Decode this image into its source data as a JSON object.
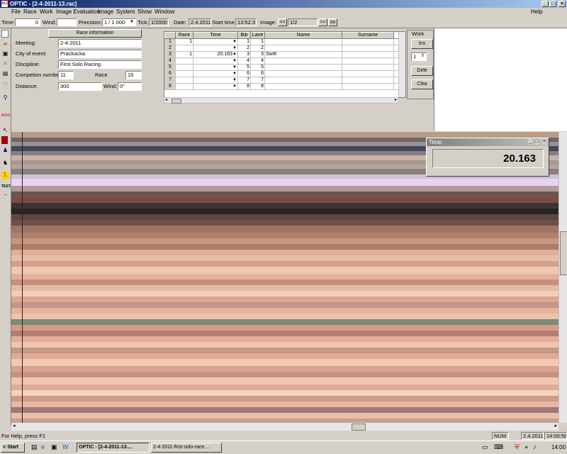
{
  "window": {
    "title": "OPTIC - [2-4-2011-13.rac]",
    "app_icon_text": "ALGE",
    "min_label": "_",
    "max_label": "□",
    "close_label": "×"
  },
  "menu": {
    "items": [
      "File",
      "Race",
      "Work",
      "Image Evaluation",
      "Image",
      "System",
      "Show",
      "Window"
    ],
    "help": "Help"
  },
  "toolbar": {
    "time_label": "Time:",
    "time_value": "0",
    "wind_label": "Wind:",
    "wind_value": "",
    "precision_label": "Precision:",
    "precision_value": "1 / 1 000",
    "tick_label": "Tick:",
    "tick_value": "1/2000",
    "date_label": "Date:",
    "date_value": "2.4.2011",
    "start_label": "Start time",
    "start_value": "13:52:37",
    "image_label": "Image:",
    "prev_label": "<<",
    "image_value": "1/2",
    "next_label": ">>",
    "link_label": "oo"
  },
  "race_info": {
    "header": "Race information",
    "meeting_label": "Meeting:",
    "meeting_value": "2-4-2011",
    "city_label": "City of event:",
    "city_value": "Prackacka",
    "discipline_label": "Discipline:",
    "discipline_value": "First Solo Racing",
    "comp_label": "Competion number:",
    "comp_value": "11",
    "race_label": "Race",
    "race_value": "15",
    "distance_label": "Distance:",
    "distance_value": "300",
    "wind_label": "Wind:",
    "wind_value": "0\""
  },
  "results": {
    "columns": [
      "",
      "Rank",
      "Time",
      "Bib",
      "Lane",
      "Name",
      "Surname"
    ],
    "rows": [
      {
        "n": "1",
        "rank": "1",
        "time": "",
        "bib": "1",
        "lane": "1",
        "name": "",
        "surname": ""
      },
      {
        "n": "2",
        "rank": "",
        "time": "",
        "bib": "2",
        "lane": "2",
        "name": "",
        "surname": ""
      },
      {
        "n": "3",
        "rank": "1",
        "time": "20.163",
        "bib": "3",
        "lane": "3",
        "name": "Swift",
        "surname": ""
      },
      {
        "n": "4",
        "rank": "",
        "time": "",
        "bib": "4",
        "lane": "4",
        "name": "",
        "surname": ""
      },
      {
        "n": "5",
        "rank": "",
        "time": "",
        "bib": "5",
        "lane": "5",
        "name": "",
        "surname": ""
      },
      {
        "n": "6",
        "rank": "",
        "time": "",
        "bib": "6",
        "lane": "6",
        "name": "",
        "surname": ""
      },
      {
        "n": "7",
        "rank": "",
        "time": "",
        "bib": "7",
        "lane": "7",
        "name": "",
        "surname": ""
      },
      {
        "n": "8",
        "rank": "",
        "time": "",
        "bib": "8",
        "lane": "8",
        "name": "",
        "surname": ""
      }
    ]
  },
  "work": {
    "header": "Work",
    "insert": "Ins",
    "spin_value": "1",
    "delete": "Dele",
    "clear": "Clea"
  },
  "time_window": {
    "title": "Time:",
    "value": "20.163"
  },
  "status": {
    "left": "For Help, press F1",
    "num": "NUM",
    "date": "2.4.2011",
    "time": "14:00:58"
  },
  "taskbar": {
    "start": "Start",
    "task1": "OPTIC - [2-4-2011-13....",
    "task2": "2-4-2011-first-solo-race....",
    "clock": "14:00"
  },
  "left_icons": [
    "new-icon",
    "open-icon",
    "save-icon",
    "delete-icon",
    "print-icon",
    "print-preview-icon",
    "zoom-icon",
    "bigg-icon",
    "pointer-icon",
    "red-marker-icon",
    "group-icon",
    "horse-icon",
    "runner-icon",
    "test-icon",
    "arrow-icon"
  ]
}
